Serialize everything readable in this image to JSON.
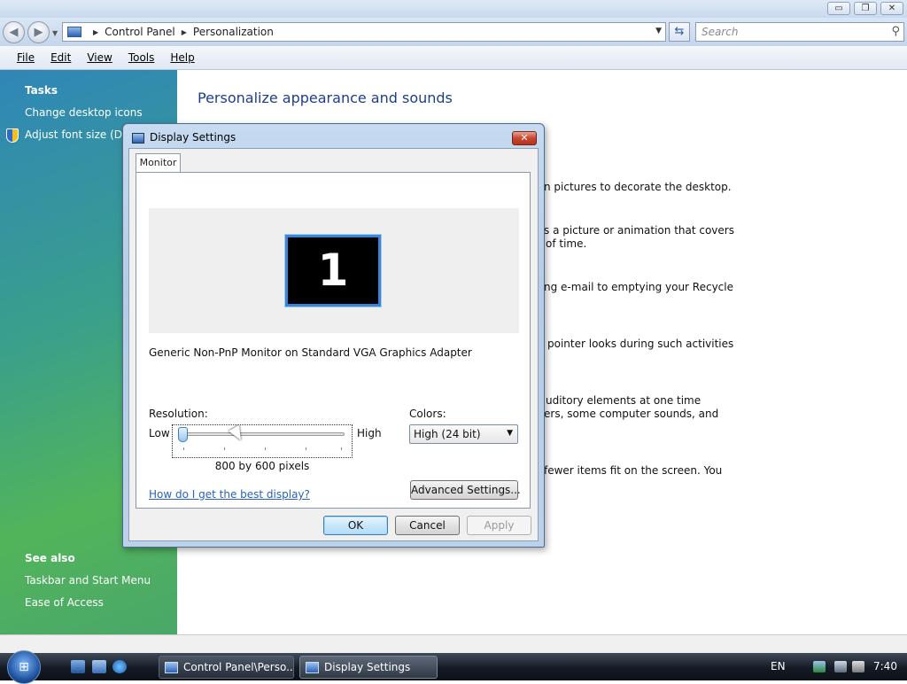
{
  "window": {
    "breadcrumb": [
      "Control Panel",
      "Personalization"
    ],
    "search_placeholder": "Search",
    "controls": {
      "minimize": "▭",
      "maximize": "❐",
      "close": "✕"
    }
  },
  "menu": [
    "File",
    "Edit",
    "View",
    "Tools",
    "Help"
  ],
  "sidebar": {
    "tasks_heading": "Tasks",
    "tasks": [
      "Change desktop icons",
      "Adjust font size (DPI)"
    ],
    "see_also_heading": "See also",
    "see_also": [
      "Taskbar and Start Menu",
      "Ease of Access"
    ]
  },
  "content": {
    "title": "Personalize appearance and sounds",
    "fragments": [
      "n pictures to decorate the desktop.",
      "s a picture or animation that covers",
      "of time.",
      "ng e-mail to emptying your Recycle",
      "pointer looks during such activities",
      "uditory elements at one time",
      "ers, some computer sounds, and",
      "fewer items fit on the screen. You"
    ]
  },
  "dialog": {
    "title": "Display Settings",
    "tab": "Monitor",
    "monitor_number": "1",
    "monitor_name": "Generic Non-PnP Monitor on Standard VGA Graphics Adapter",
    "resolution_label": "Resolution:",
    "low_label": "Low",
    "high_label": "High",
    "resolution_value": "800 by 600 pixels",
    "resolution_level": 0.0,
    "colors_label": "Colors:",
    "colors_value": "High (24 bit)",
    "help_link": "How do I get the best display?",
    "advanced_button": "Advanced Settings...",
    "ok_button": "OK",
    "cancel_button": "Cancel",
    "apply_button": "Apply"
  },
  "taskbar": {
    "buttons": [
      "Control Panel\\Perso...",
      "Display Settings"
    ],
    "language": "EN",
    "clock": "7:40"
  }
}
